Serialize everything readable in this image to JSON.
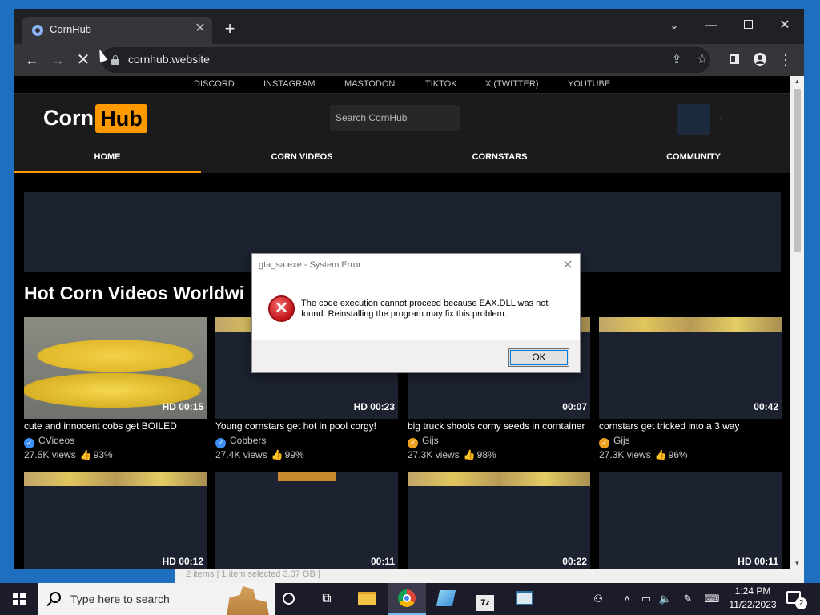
{
  "browser": {
    "tab_title": "CornHub",
    "tab_close": "✕",
    "new_tab": "+",
    "url": "cornhub.website",
    "icons": [
      "favicon-icon",
      "back-icon",
      "forward-icon",
      "stop-icon",
      "lock-icon",
      "share-icon",
      "star-icon",
      "side-panel-icon",
      "profile-icon",
      "menu-icon"
    ]
  },
  "site": {
    "social_links": [
      "DISCORD",
      "INSTAGRAM",
      "MASTODON",
      "TIKTOK",
      "X (TWITTER)",
      "YOUTUBE"
    ],
    "logo": {
      "left": "Corn",
      "right": "Hub"
    },
    "search_placeholder": "Search CornHub",
    "nav": [
      {
        "label": "HOME",
        "active": true
      },
      {
        "label": "CORN VIDEOS",
        "active": false
      },
      {
        "label": "CORNSTARS",
        "active": false
      },
      {
        "label": "COMMUNITY",
        "active": false
      }
    ],
    "accent_color": "#ff9900",
    "section_title": "Hot Corn Videos Worldwi",
    "videos": [
      {
        "duration": "HD 00:15",
        "title": "cute and innocent cobs get BOILED",
        "channel": "CVideos",
        "badge": "blue",
        "views": "27.5K views",
        "rating": "93%"
      },
      {
        "duration": "HD 00:23",
        "title": "Young cornstars get hot in pool corgy!",
        "channel": "Cobbers",
        "badge": "blue",
        "views": "27.4K views",
        "rating": "99%"
      },
      {
        "duration": "00:07",
        "title": "big truck shoots corny seeds in corntainer",
        "channel": "Gijs",
        "badge": "orange",
        "views": "27.3K views",
        "rating": "98%"
      },
      {
        "duration": "00:42",
        "title": "cornstars get tricked into a 3 way",
        "channel": "Gijs",
        "badge": "orange",
        "views": "27.3K views",
        "rating": "96%"
      },
      {
        "duration": "HD 00:12"
      },
      {
        "duration": "00:11"
      },
      {
        "duration": "00:22"
      },
      {
        "duration": "HD 00:11"
      }
    ]
  },
  "dialog": {
    "title": "gta_sa.exe - System Error",
    "message": "The code execution cannot proceed because EAX.DLL was not found. Reinstalling the program may fix this problem.",
    "ok_label": "OK"
  },
  "explorer_status": "2 items  |  1 item selected  3.07 GB  |",
  "taskbar": {
    "search_placeholder": "Type here to search",
    "clock_time": "1:24 PM",
    "clock_date": "11/22/2023",
    "notification_count": "2",
    "sevenzip_label": "7z"
  }
}
